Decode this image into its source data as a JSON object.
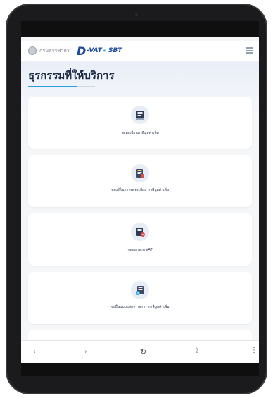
{
  "header": {
    "rd_logo_text": "กรมสรรพากร",
    "vat_logo": {
      "d": "D",
      "main": "-VAT",
      "dot": "•",
      "sbt": "SBT"
    },
    "menu_icon": "menu-icon"
  },
  "page": {
    "title": "ธุรกรรมที่ให้บริการ"
  },
  "cards": [
    {
      "icon": "document-register-icon",
      "label": "จดทะเบียนภาษีมูลค่าเพิ่ม"
    },
    {
      "icon": "document-edit-icon",
      "label": "ขอแก้ไขการจดทะเบียน ภาษีมูลค่าเพิ่ม"
    },
    {
      "icon": "vat-exit-icon",
      "label": "ขอออกจาก VAT"
    },
    {
      "icon": "document-submit-icon",
      "label": "ขอยื่นแบบแสดงรายการ ภาษีมูลค่าเพิ่ม"
    }
  ],
  "browser": {
    "back": "‹",
    "forward": "›",
    "reload": "↻",
    "share": "⇪",
    "more": "⋮"
  },
  "colors": {
    "brand": "#1c4a9c",
    "accent": "#2a9ee6",
    "title": "#1f2d45"
  }
}
